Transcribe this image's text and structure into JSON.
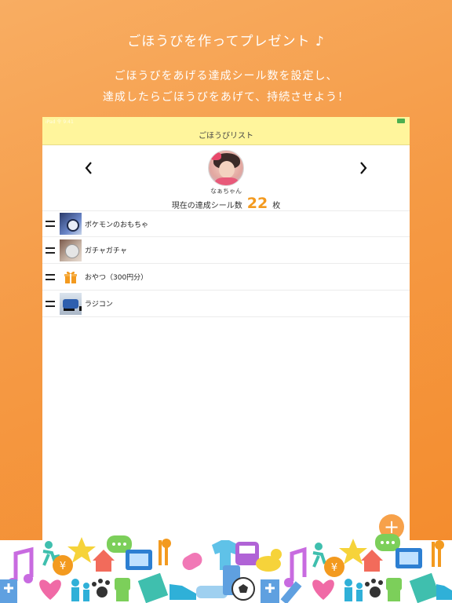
{
  "promo": {
    "title": "ごほうびを作ってプレゼント ♪",
    "line1": "ごほうびをあげる達成シール数を設定し、",
    "line2": "達成したらごほうびをあげて、持続させよう！"
  },
  "statusbar": {
    "left": "iPad 令 9:41",
    "right": "100%"
  },
  "navbar": {
    "title": "ごほうびリスト"
  },
  "profile": {
    "name": "なぁちゃん",
    "count_prefix": "現在の達成シール数",
    "count_value": "22",
    "count_unit": "枚"
  },
  "rewards": [
    {
      "label": "ポケモンのおもちゃ",
      "icon": "pokemon-toy-photo"
    },
    {
      "label": "ガチャガチャ",
      "icon": "gacha-capsule-photo"
    },
    {
      "label": "おやつ（300円分）",
      "icon": "gift-icon"
    },
    {
      "label": "ラジコン",
      "icon": "rc-car-photo"
    }
  ],
  "fab": {
    "symbol": "+"
  },
  "colors": {
    "accent": "#f39a1f",
    "navbar": "#fff59c",
    "background": "#f59a45",
    "fab": "#f7a14a"
  }
}
